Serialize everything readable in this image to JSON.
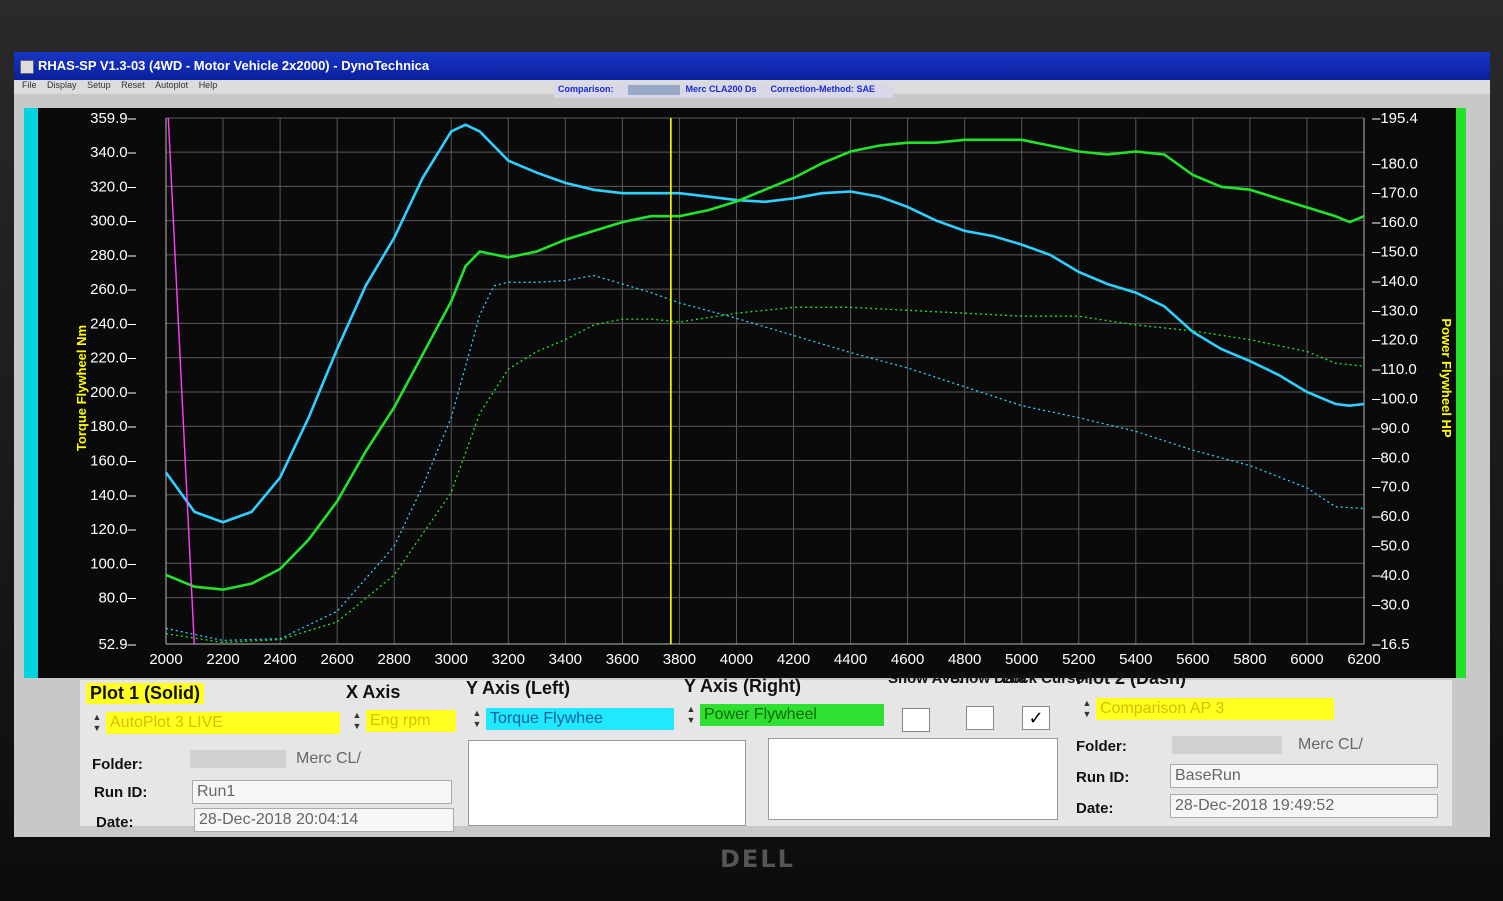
{
  "window": {
    "title": "RHAS-SP V1.3-03  (4WD - Motor Vehicle 2x2000) - DynoTechnica",
    "menu": [
      "File",
      "Display",
      "Setup",
      "Reset",
      "Autoplot",
      "Help"
    ]
  },
  "info": {
    "comparison_label": "Comparison:",
    "comparison_value": "Merc CLA200 Ds",
    "correction_label": "Correction-Method: SAE"
  },
  "controls": {
    "plot1": {
      "label": "Plot 1 (Solid)",
      "value": "AutoPlot 3 LIVE"
    },
    "x_axis": {
      "label": "X Axis",
      "value": "Eng rpm"
    },
    "y_left": {
      "label": "Y Axis (Left)",
      "value": "Torque Flywhee"
    },
    "y_right": {
      "label": "Y Axis (Right)",
      "value": "Power Flywheel"
    },
    "show_ave": "Show Ave.",
    "show_data": "Show Data",
    "lock_cursor": "Lock Cursor",
    "lock_cursor_checked": "✓",
    "plot2": {
      "label": "Plot 2 (Dash)",
      "value": "Comparison AP 3"
    },
    "left_run": {
      "folder_label": "Folder:",
      "folder": "Merc CL/",
      "run_label": "Run ID:",
      "run": "Run1",
      "date_label": "Date:",
      "date": "28-Dec-2018  20:04:14"
    },
    "right_run": {
      "folder_label": "Folder:",
      "folder": "Merc CL/",
      "run_label": "Run ID:",
      "run": "BaseRun",
      "date_label": "Date:",
      "date": "28-Dec-2018  19:49:52"
    }
  },
  "brand": "DELL",
  "chart_data": {
    "type": "line",
    "xlim": [
      2000,
      6200
    ],
    "ylim_left": [
      52.9,
      359.9
    ],
    "ylim_right": [
      16.5,
      195.4
    ],
    "x_ticks": [
      "2000",
      "2200",
      "2400",
      "2600",
      "2800",
      "3000",
      "3200",
      "3400",
      "3600",
      "3800",
      "4000",
      "4200",
      "4400",
      "4600",
      "4800",
      "5000",
      "5200",
      "5400",
      "5600",
      "5800",
      "6000",
      "6200"
    ],
    "y_left_ticks": [
      "52.9",
      "80.0",
      "100.0",
      "120.0",
      "140.0",
      "160.0",
      "180.0",
      "200.0",
      "220.0",
      "240.0",
      "260.0",
      "280.0",
      "300.0",
      "320.0",
      "340.0",
      "359.9"
    ],
    "y_right_ticks": [
      "16.5",
      "30.0",
      "40.0",
      "50.0",
      "60.0",
      "70.0",
      "80.0",
      "90.0",
      "100.0",
      "110.0",
      "120.0",
      "130.0",
      "140.0",
      "150.0",
      "160.0",
      "170.0",
      "180.0",
      "195.4"
    ],
    "ylabel_left": "Torque Flywheel Nm",
    "ylabel_right": "Power Flywheel HP",
    "cursor_x": 3770,
    "marker_x": 2050,
    "colors": {
      "torque": "#2fd0ff",
      "power": "#22e22a",
      "cursor": "#ffff00",
      "marker": "#ff40ff"
    },
    "series": [
      {
        "axis": "left",
        "color": "torque",
        "style": "solid",
        "x": [
          2000,
          2100,
          2200,
          2300,
          2400,
          2500,
          2600,
          2700,
          2800,
          2900,
          3000,
          3050,
          3100,
          3200,
          3300,
          3400,
          3500,
          3600,
          3700,
          3800,
          3900,
          4000,
          4100,
          4200,
          4300,
          4400,
          4500,
          4600,
          4700,
          4800,
          4900,
          5000,
          5100,
          5200,
          5300,
          5400,
          5500,
          5600,
          5700,
          5800,
          5900,
          6000,
          6100,
          6150,
          6200
        ],
        "y": [
          153,
          130,
          124,
          130,
          150,
          185,
          225,
          262,
          290,
          325,
          352,
          356,
          352,
          335,
          328,
          322,
          318,
          316,
          316,
          316,
          314,
          312,
          311,
          313,
          316,
          317,
          314,
          308,
          300,
          294,
          291,
          286,
          280,
          270,
          263,
          258,
          250,
          235,
          225,
          218,
          210,
          200,
          193,
          192,
          193
        ]
      },
      {
        "axis": "right",
        "color": "power",
        "style": "solid",
        "x": [
          2000,
          2100,
          2200,
          2300,
          2400,
          2500,
          2600,
          2700,
          2800,
          2900,
          3000,
          3050,
          3100,
          3200,
          3300,
          3400,
          3500,
          3600,
          3700,
          3800,
          3900,
          4000,
          4100,
          4200,
          4300,
          4400,
          4500,
          4600,
          4700,
          4800,
          4900,
          5000,
          5100,
          5200,
          5300,
          5400,
          5500,
          5600,
          5700,
          5800,
          5900,
          6000,
          6100,
          6150,
          6200
        ],
        "y": [
          40,
          36,
          35,
          37,
          42,
          52,
          65,
          82,
          97,
          115,
          133,
          145,
          150,
          148,
          150,
          154,
          157,
          160,
          162,
          162,
          164,
          167,
          171,
          175,
          180,
          184,
          186,
          187,
          187,
          188,
          188,
          188,
          186,
          184,
          183,
          184,
          183,
          176,
          172,
          171,
          168,
          165,
          162,
          160,
          162
        ]
      },
      {
        "axis": "left",
        "color": "torque",
        "style": "dashed",
        "x": [
          2000,
          2200,
          2400,
          2600,
          2800,
          2900,
          3000,
          3100,
          3150,
          3200,
          3300,
          3400,
          3500,
          3600,
          3700,
          3800,
          4000,
          4200,
          4400,
          4600,
          4800,
          5000,
          5200,
          5400,
          5600,
          5800,
          6000,
          6100,
          6200
        ],
        "y": [
          62,
          55,
          56,
          72,
          110,
          145,
          185,
          245,
          262,
          264,
          264,
          265,
          268,
          263,
          258,
          252,
          243,
          233,
          223,
          214,
          203,
          192,
          185,
          177,
          166,
          157,
          144,
          133,
          132
        ]
      },
      {
        "axis": "right",
        "color": "power",
        "style": "dashed",
        "x": [
          2000,
          2200,
          2400,
          2600,
          2800,
          3000,
          3100,
          3200,
          3300,
          3400,
          3500,
          3600,
          3700,
          3800,
          4000,
          4200,
          4400,
          4600,
          4800,
          5000,
          5200,
          5400,
          5600,
          5800,
          6000,
          6100,
          6200
        ],
        "y": [
          20,
          17,
          18,
          24,
          40,
          68,
          95,
          110,
          116,
          120,
          125,
          127,
          127,
          126,
          129,
          131,
          131,
          130,
          129,
          128,
          128,
          125,
          123,
          120,
          116,
          112,
          111
        ]
      }
    ]
  }
}
